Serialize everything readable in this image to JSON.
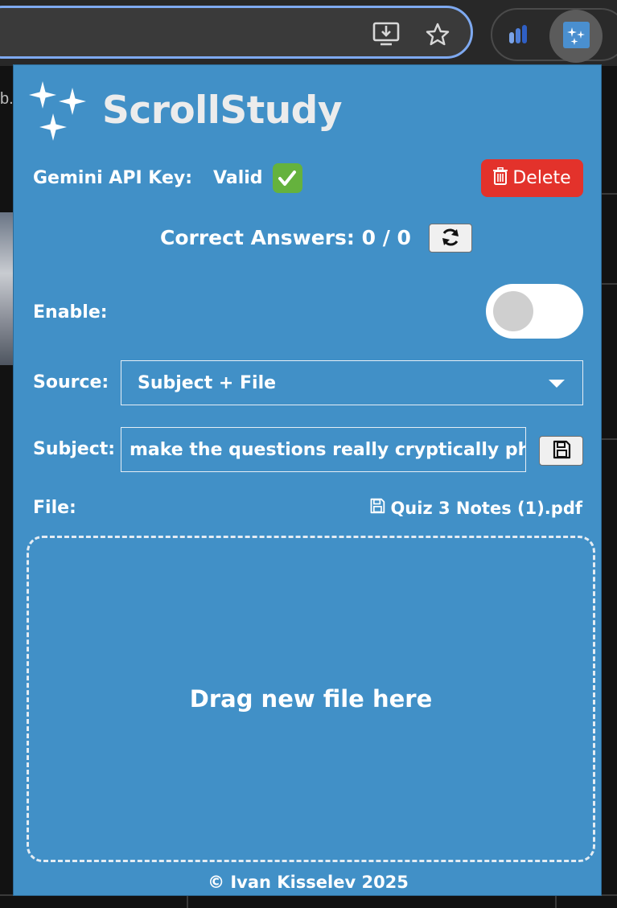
{
  "browser": {
    "tab_fragment": "b."
  },
  "popup": {
    "brand": "ScrollStudy",
    "api": {
      "label": "Gemini API Key:",
      "status": "Valid",
      "delete_label": "Delete"
    },
    "correct_answers": {
      "label": "Correct Answers:",
      "value": "0 / 0"
    },
    "enable": {
      "label": "Enable:",
      "enabled": false
    },
    "source": {
      "label": "Source:",
      "selected": "Subject + File"
    },
    "subject": {
      "label": "Subject:",
      "value": "make the questions really cryptically phrased"
    },
    "file": {
      "label": "File:",
      "name": "Quiz 3 Notes (1).pdf"
    },
    "dropzone_text": "Drag new file here",
    "footer": "© Ivan Kisselev 2025"
  },
  "colors": {
    "popup_bg": "#4190c7",
    "delete_bg": "#e3322b",
    "check_bg": "#65b23d",
    "omnibox_border": "#7ea9f0"
  },
  "icons": {
    "install": "install-app-icon",
    "bookmark": "star-icon",
    "extension_1": "bar-chart-extension-icon",
    "extension_2": "sparkle-extension-icon",
    "delete": "trash-icon",
    "refresh": "refresh-icon",
    "save": "floppy-disk-icon",
    "file": "floppy-disk-icon",
    "check": "check-mark-icon"
  }
}
